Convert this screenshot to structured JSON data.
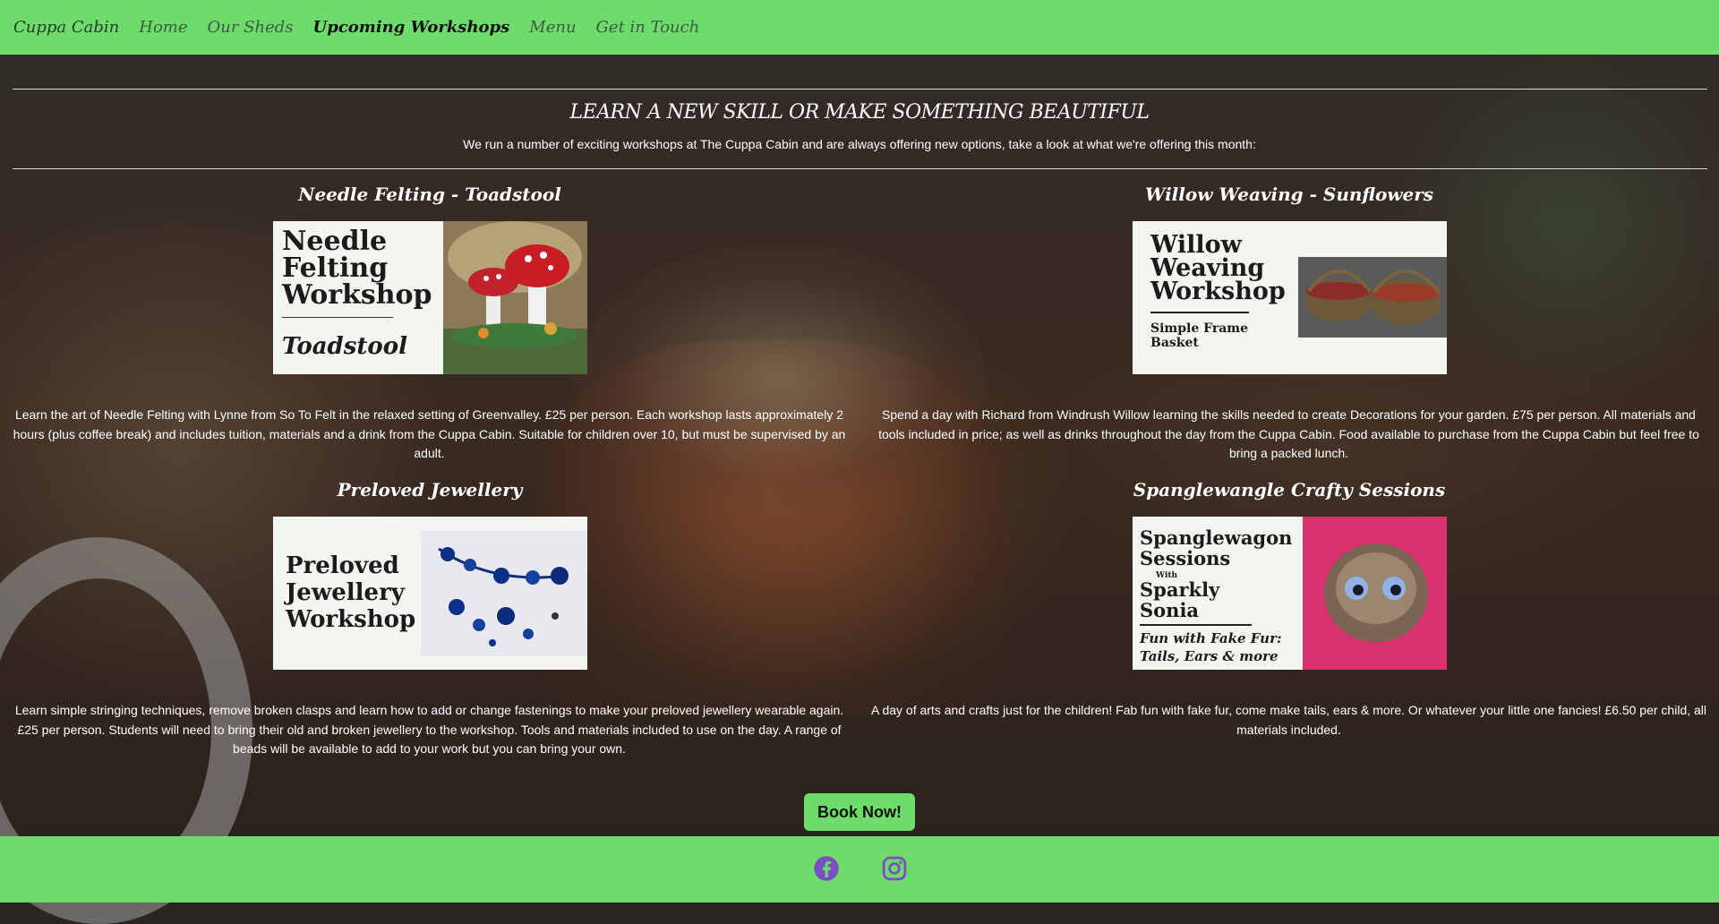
{
  "nav": {
    "brand": "Cuppa Cabin",
    "items": [
      {
        "label": "Home",
        "active": false
      },
      {
        "label": "Our Sheds",
        "active": false
      },
      {
        "label": "Upcoming Workshops",
        "active": true
      },
      {
        "label": "Menu",
        "active": false
      },
      {
        "label": "Get in Touch",
        "active": false
      }
    ]
  },
  "header": {
    "headline": "LEARN A NEW SKILL OR MAKE SOMETHING BEAUTIFUL",
    "intro": "We run a number of exciting workshops at The Cuppa Cabin and are always offering new options, take a look at what we're offering this month:"
  },
  "workshops": [
    {
      "title": "Needle Felting - Toadstool",
      "card": {
        "line1": "Needle",
        "line2": "Felting",
        "line3": "Workshop",
        "sub": "Toadstool"
      },
      "description": "Learn the art of Needle Felting with Lynne from So To Felt in the relaxed setting of Greenvalley. £25 per person. Each workshop lasts approximately 2 hours (plus coffee break) and includes tuition, materials and a drink from the Cuppa Cabin. Suitable for children over 10, but must be supervised by an adult."
    },
    {
      "title": "Willow Weaving - Sunflowers",
      "card": {
        "line1": "Willow",
        "line2": "Weaving",
        "line3": "Workshop",
        "sub1": "Simple Frame",
        "sub2": "Basket"
      },
      "description": "Spend a day with Richard from Windrush Willow learning the skills needed to create Decorations for your garden. £75 per person. All materials and tools included in price; as well as drinks throughout the day from the Cuppa Cabin. Food available to purchase from the Cuppa Cabin but feel free to bring a packed lunch."
    },
    {
      "title": "Preloved Jewellery",
      "card": {
        "line1": "Preloved",
        "line2": "Jewellery",
        "line3": "Workshop"
      },
      "description": "Learn simple stringing techniques, remove broken clasps and learn how to add or change fastenings to make your preloved jewellery wearable again. £25 per person. Students will need to bring their old and broken jewellery to the workshop. Tools and materials included to use on the day. A range of beads will be available to add to your work but you can bring your own."
    },
    {
      "title": "Spanglewangle Crafty Sessions",
      "card": {
        "line1": "Spanglewagon",
        "line2": "Sessions",
        "with": "With",
        "line3": "Sparkly",
        "line4": "Sonia",
        "sub1": "Fun with Fake Fur:",
        "sub2": "Tails, Ears & more"
      },
      "description": "A day of arts and crafts just for the children! Fab fun with fake fur, come make tails, ears & more. Or whatever your little one fancies! £6.50 per child, all materials included."
    }
  ],
  "cta": {
    "book_label": "Book Now!"
  },
  "footer": {
    "icons": [
      "facebook-icon",
      "instagram-icon"
    ],
    "icon_color": "#7a4fc2"
  },
  "colors": {
    "nav_bg": "#6ddc6a",
    "footer_bg": "#6ddc6a"
  }
}
